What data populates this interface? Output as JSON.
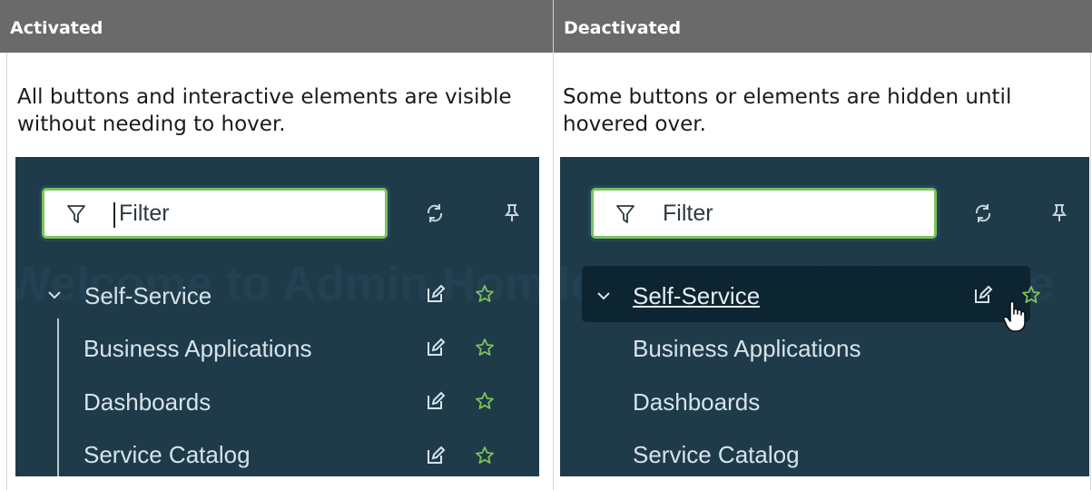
{
  "header": {
    "left_label": "Activated",
    "right_label": "Deactivated"
  },
  "descriptions": {
    "left": "All buttons and interactive elements are visible without needing to hover.",
    "right": "Some buttons or elements are hidden until hovered over."
  },
  "panels": {
    "background_text": "Welcome to Admin Home",
    "filter_placeholder": "Filter",
    "tree": {
      "parent": "Self-Service",
      "children": [
        "Business Applications",
        "Dashboards",
        "Service Catalog"
      ]
    }
  },
  "icons": {
    "filter": "filter-icon",
    "refresh": "refresh-icon",
    "pin": "pin-icon",
    "edit": "edit-icon",
    "favorite": "star-icon",
    "expand": "chevron-down-icon",
    "cursor": "hand-pointer-icon"
  },
  "colors": {
    "header_bg": "#6a6a6a",
    "panel_bg": "#1f3b4a",
    "accent_green": "#7cc35c",
    "hover_row_bg": "#0d2431",
    "nav_text": "#d6e3ea"
  }
}
